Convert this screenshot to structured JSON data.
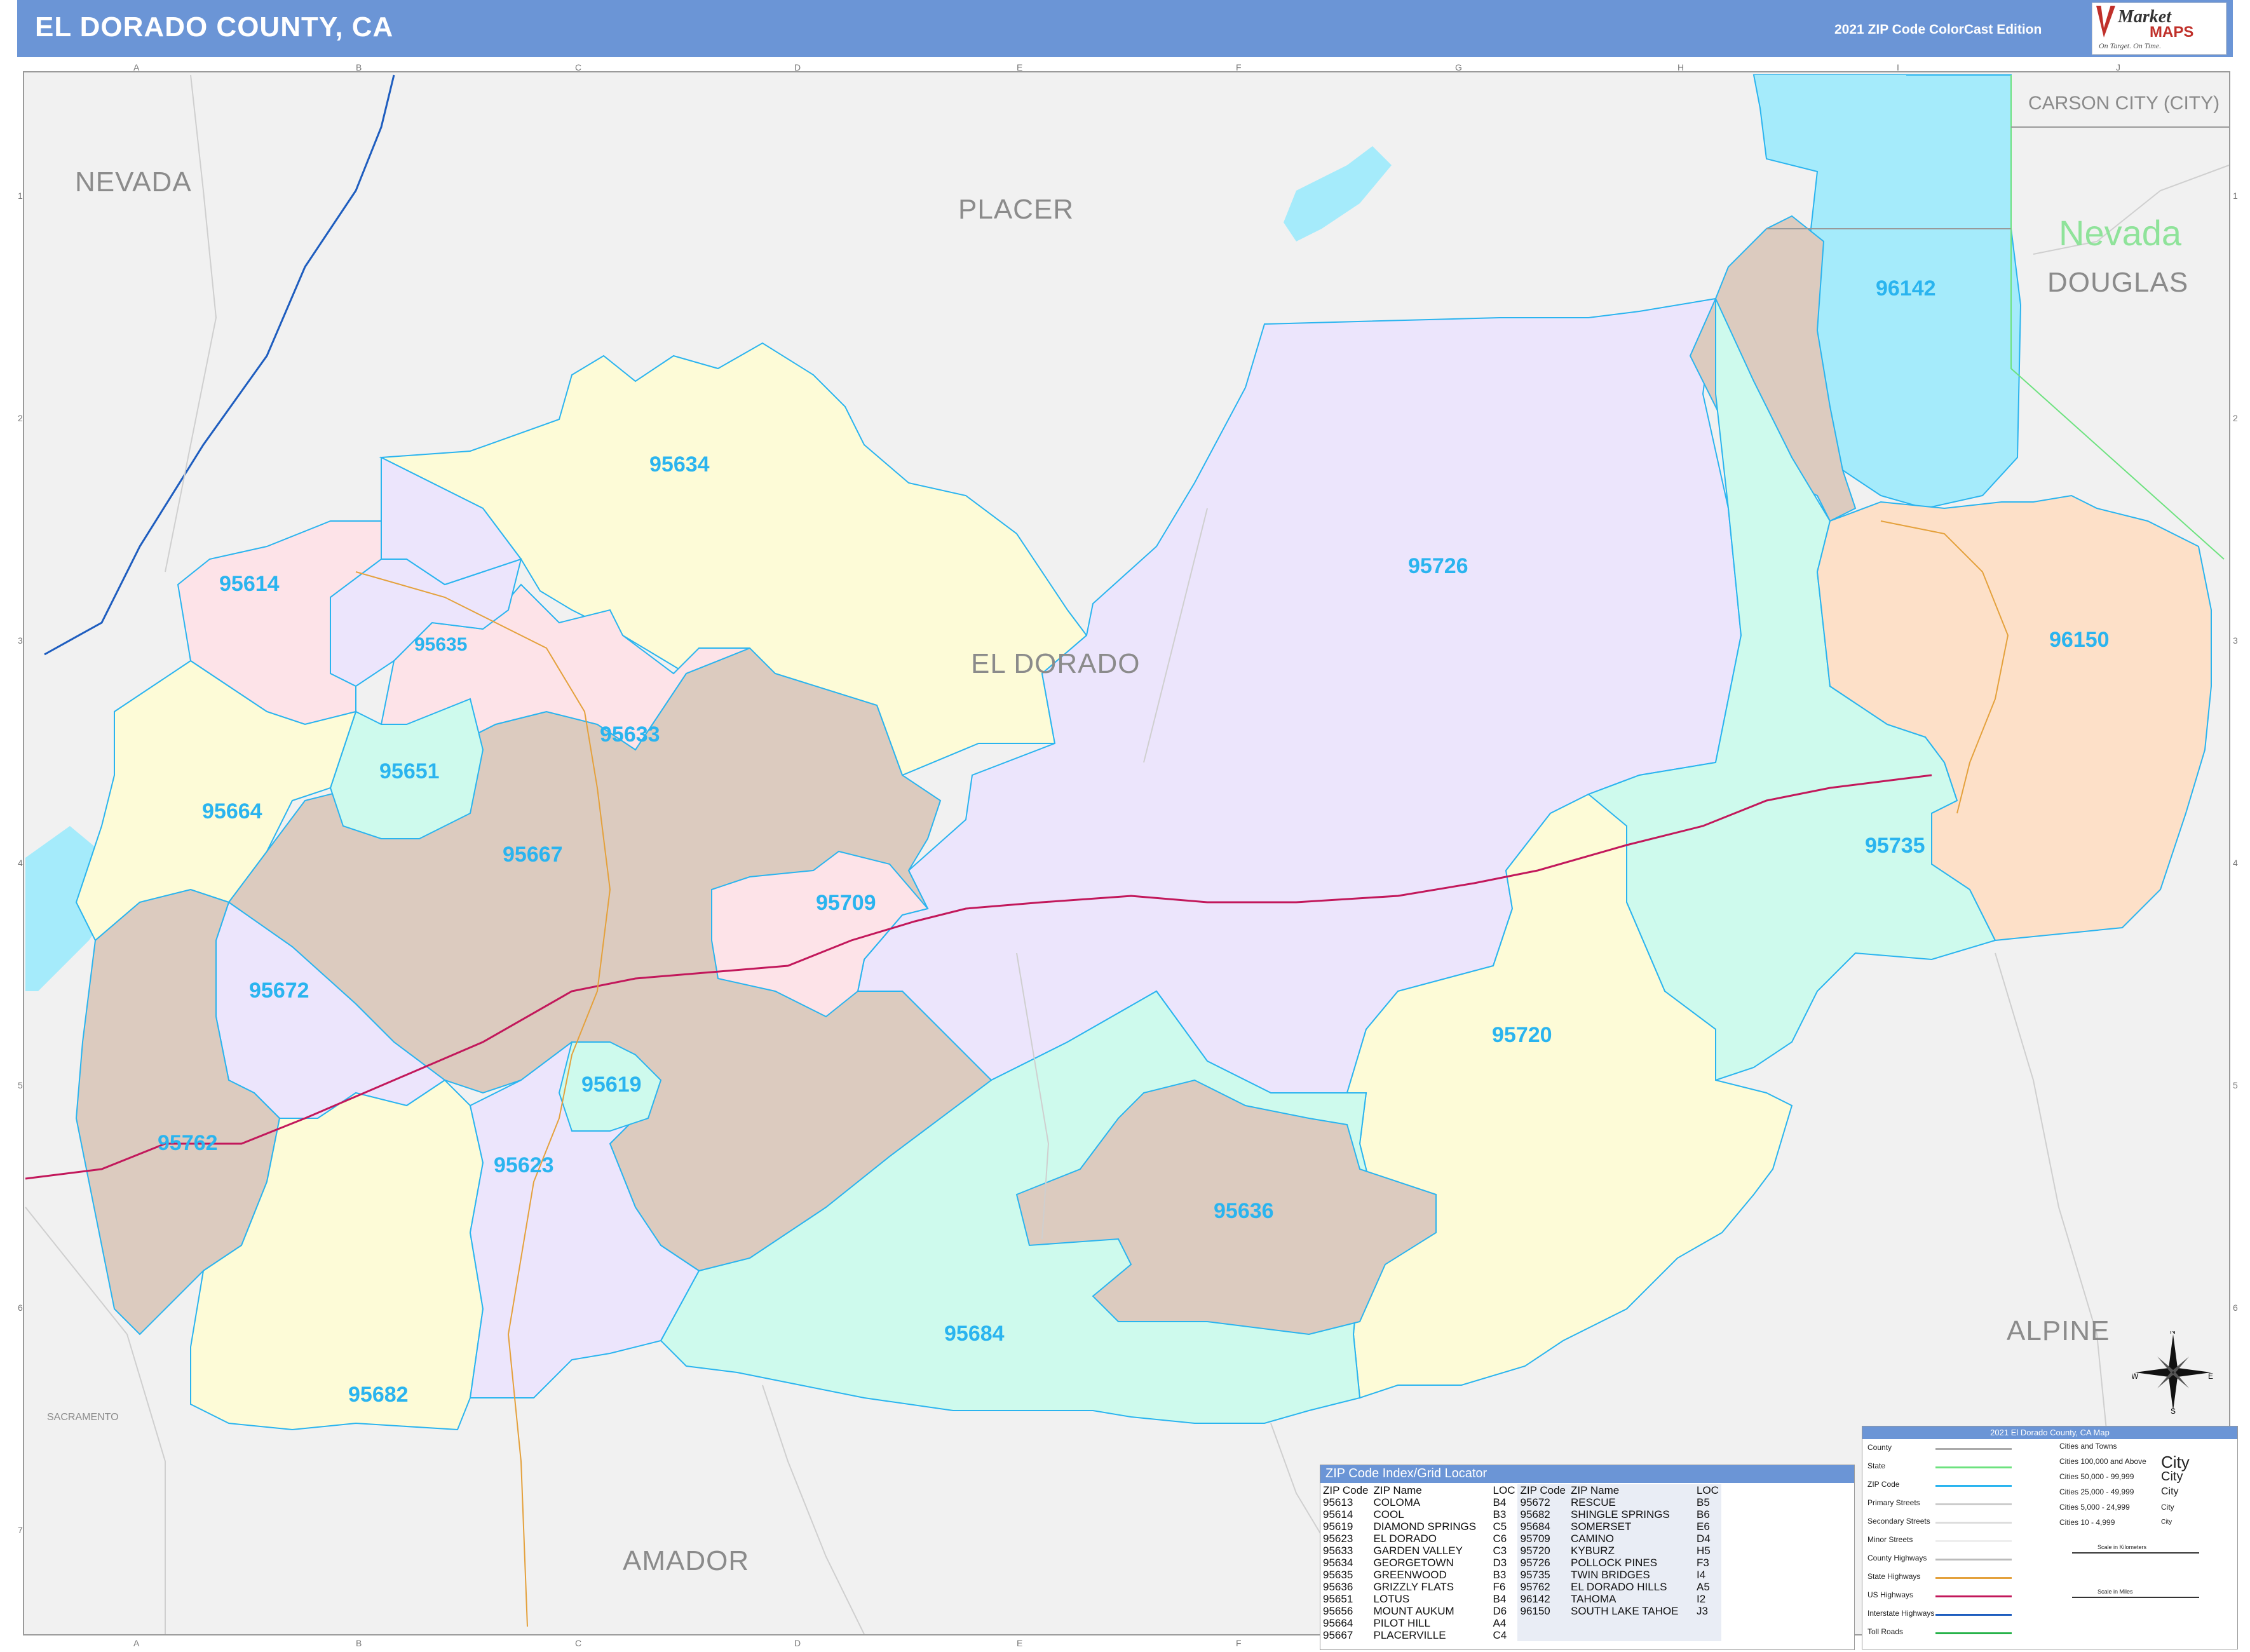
{
  "header": {
    "title": "EL DORADO COUNTY, CA",
    "edition": "2021 ZIP Code ColorCast Edition",
    "logo_market": "Market",
    "logo_maps": "MAPS",
    "logo_tagline": "On Target. On Time."
  },
  "grid": {
    "cols": [
      "A",
      "B",
      "C",
      "D",
      "E",
      "F",
      "G",
      "H",
      "I",
      "J"
    ],
    "rows": [
      "1",
      "2",
      "3",
      "4",
      "5",
      "6",
      "7"
    ]
  },
  "regions": {
    "nevada_top": "NEVADA",
    "placer": "PLACER",
    "el_dorado": "EL DORADO",
    "carson_city": "CARSON CITY (CITY)",
    "nevada_state": "Nevada",
    "douglas": "DOUGLAS",
    "alpine": "ALPINE",
    "amador": "AMADOR",
    "sacramento": "SACRAMENTO"
  },
  "zips": {
    "z95634": "95634",
    "z95726": "95726",
    "z96142": "96142",
    "z95614": "95614",
    "z95635": "95635",
    "z96150": "96150",
    "z95633": "95633",
    "z95651": "95651",
    "z95664": "95664",
    "z95667": "95667",
    "z95709": "95709",
    "z95735": "95735",
    "z95672": "95672",
    "z95720": "95720",
    "z95619": "95619",
    "z95762": "95762",
    "z95623": "95623",
    "z95636": "95636",
    "z95684": "95684",
    "z95682": "95682"
  },
  "colors": {
    "yellow": "#fdfbd7",
    "purple": "#ece5fc",
    "pink": "#fde3e8",
    "tan": "#dccbbf",
    "mint": "#cefaed",
    "peach": "#fde0c8",
    "water": "#a5ebfb",
    "zip_label": "#2ab4ef",
    "highway": "#c2185b",
    "interstate": "#1e5dbf"
  },
  "index": {
    "title": "ZIP Code Index/Grid Locator",
    "headers": [
      "ZIP Code",
      "ZIP Name",
      "LOC",
      "ZIP Code",
      "ZIP Name",
      "LOC"
    ],
    "left": [
      [
        "95613",
        "COLOMA",
        "B4"
      ],
      [
        "95614",
        "COOL",
        "B3"
      ],
      [
        "95619",
        "DIAMOND SPRINGS",
        "C5"
      ],
      [
        "95623",
        "EL DORADO",
        "C6"
      ],
      [
        "95633",
        "GARDEN VALLEY",
        "C3"
      ],
      [
        "95634",
        "GEORGETOWN",
        "D3"
      ],
      [
        "95635",
        "GREENWOOD",
        "B3"
      ],
      [
        "95636",
        "GRIZZLY FLATS",
        "F6"
      ],
      [
        "95651",
        "LOTUS",
        "B4"
      ],
      [
        "95656",
        "MOUNT AUKUM",
        "D6"
      ],
      [
        "95664",
        "PILOT HILL",
        "A4"
      ],
      [
        "95667",
        "PLACERVILLE",
        "C4"
      ]
    ],
    "right": [
      [
        "95672",
        "RESCUE",
        "B5"
      ],
      [
        "95682",
        "SHINGLE SPRINGS",
        "B6"
      ],
      [
        "95684",
        "SOMERSET",
        "E6"
      ],
      [
        "95709",
        "CAMINO",
        "D4"
      ],
      [
        "95720",
        "KYBURZ",
        "H5"
      ],
      [
        "95726",
        "POLLOCK PINES",
        "F3"
      ],
      [
        "95735",
        "TWIN BRIDGES",
        "I4"
      ],
      [
        "95762",
        "EL DORADO HILLS",
        "A5"
      ],
      [
        "96142",
        "TAHOMA",
        "I2"
      ],
      [
        "96150",
        "SOUTH LAKE TAHOE",
        "J3"
      ]
    ]
  },
  "legend": {
    "title": "2021 El Dorado County, CA Map",
    "lines": [
      "County",
      "State",
      "ZIP Code",
      "Primary Streets",
      "Secondary Streets",
      "Minor Streets",
      "County Highways",
      "State Highways",
      "US Highways",
      "Interstate Highways",
      "Toll Roads"
    ],
    "cities_title": "Cities and Towns",
    "cities": [
      {
        "label": "Cities 100,000 and Above",
        "sample": "City"
      },
      {
        "label": "Cities 50,000 - 99,999",
        "sample": "City"
      },
      {
        "label": "Cities 25,000 - 49,999",
        "sample": "City"
      },
      {
        "label": "Cities 5,000 - 24,999",
        "sample": "City"
      },
      {
        "label": "Cities 10 - 4,999",
        "sample": "City"
      }
    ],
    "scale_km": "Scale in Kilometers",
    "scale_mi": "Scale in Miles"
  },
  "compass": {
    "n": "N",
    "s": "S",
    "e": "E",
    "w": "W"
  }
}
